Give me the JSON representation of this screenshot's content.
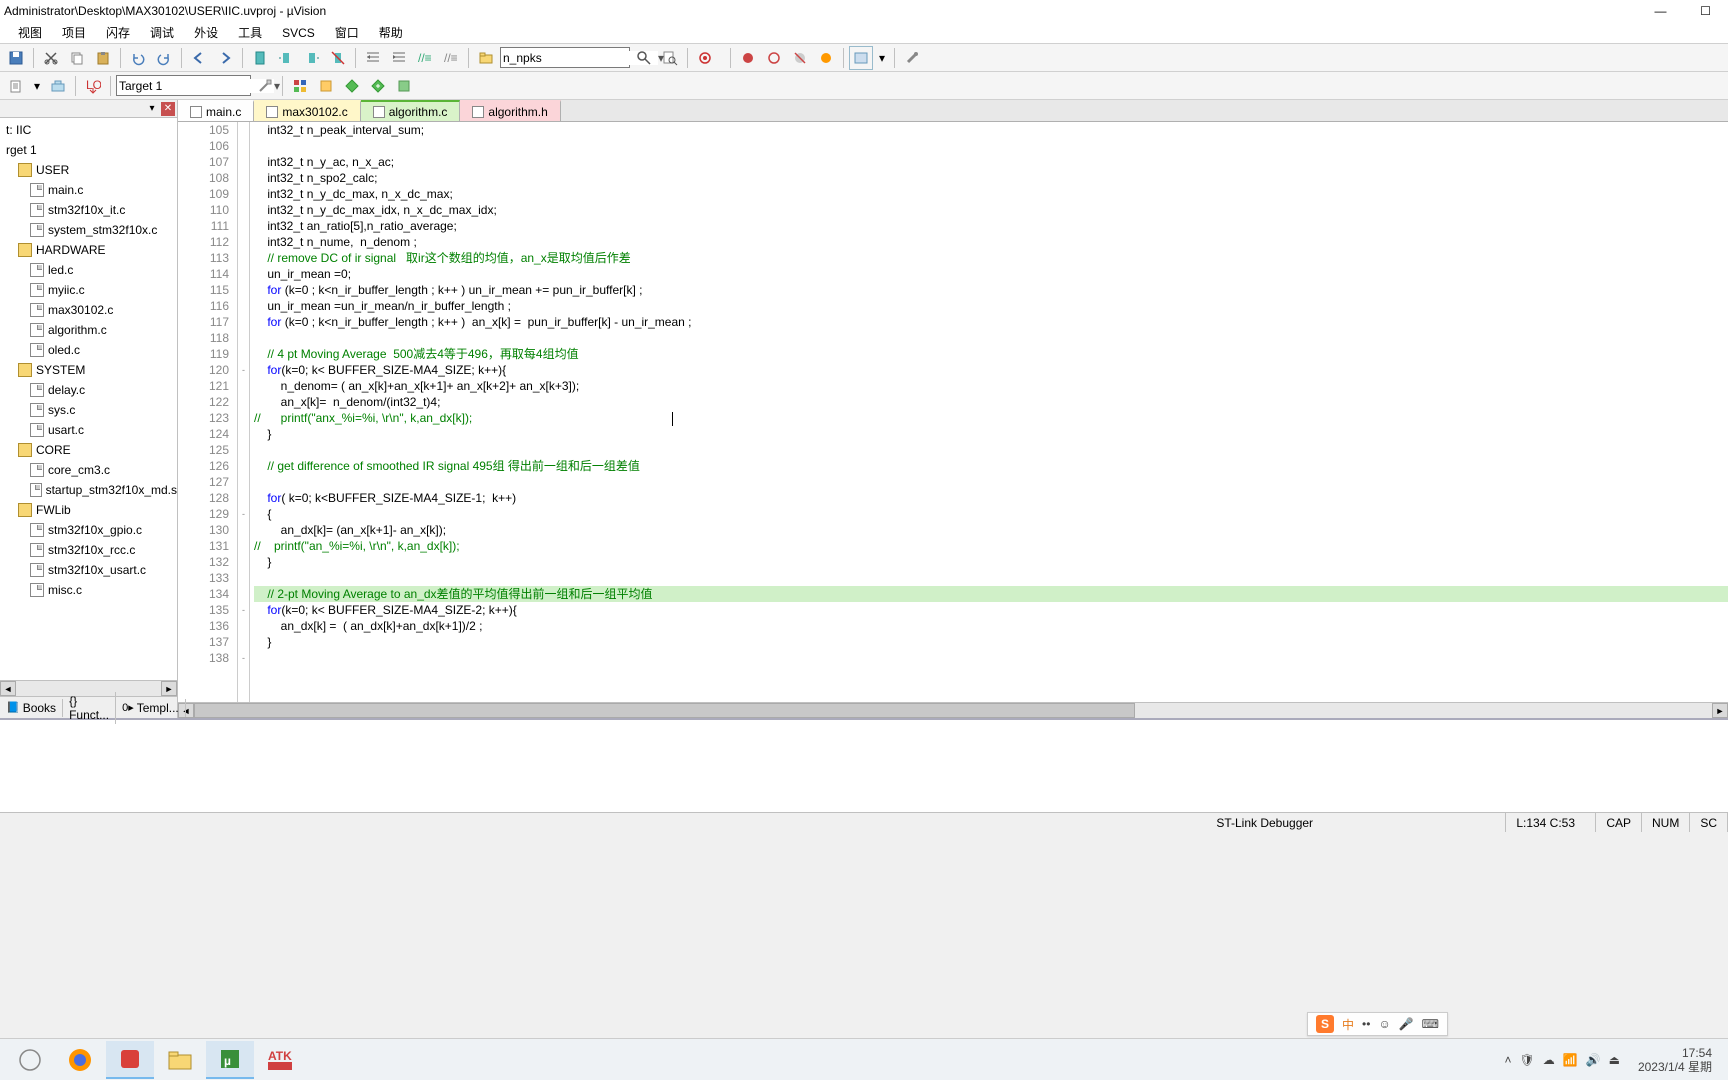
{
  "window": {
    "title": "Administrator\\Desktop\\MAX30102\\USER\\IIC.uvproj - µVision"
  },
  "menu": [
    "视图",
    "项目",
    "闪存",
    "调试",
    "外设",
    "工具",
    "SVCS",
    "窗口",
    "帮助"
  ],
  "toolbar1": {
    "combo": "n_npks"
  },
  "toolbar2": {
    "target": "Target 1"
  },
  "project": {
    "breadcrumb": "t: IIC",
    "target": "rget 1",
    "groups": [
      {
        "name": "USER",
        "files": [
          "main.c",
          "stm32f10x_it.c",
          "system_stm32f10x.c"
        ]
      },
      {
        "name": "HARDWARE",
        "files": [
          "led.c",
          "myiic.c",
          "max30102.c",
          "algorithm.c",
          "oled.c"
        ]
      },
      {
        "name": "SYSTEM",
        "files": [
          "delay.c",
          "sys.c",
          "usart.c"
        ]
      },
      {
        "name": "CORE",
        "files": [
          "core_cm3.c",
          "startup_stm32f10x_md.s"
        ]
      },
      {
        "name": "FWLib",
        "files": [
          "stm32f10x_gpio.c",
          "stm32f10x_rcc.c",
          "stm32f10x_usart.c",
          "misc.c"
        ]
      }
    ],
    "tabs": {
      "books": "Books",
      "funcs": "{} Funct...",
      "templates": "Templ..."
    }
  },
  "editor": {
    "tabs": [
      {
        "name": "main.c",
        "style": "inactive"
      },
      {
        "name": "max30102.c",
        "style": "yellow"
      },
      {
        "name": "algorithm.c",
        "style": "green"
      },
      {
        "name": "algorithm.h",
        "style": "pink"
      }
    ],
    "first_line": 105,
    "lines": [
      {
        "raw": "    int32_t n_peak_interval_sum;"
      },
      {
        "raw": ""
      },
      {
        "raw": "    int32_t n_y_ac, n_x_ac;"
      },
      {
        "raw": "    int32_t n_spo2_calc;"
      },
      {
        "raw": "    int32_t n_y_dc_max, n_x_dc_max;"
      },
      {
        "raw": "    int32_t n_y_dc_max_idx, n_x_dc_max_idx;"
      },
      {
        "raw": "    int32_t an_ratio[5],n_ratio_average;"
      },
      {
        "raw": "    int32_t n_nume,  n_denom ;"
      },
      {
        "cmt": "    // remove DC of ir signal   取ir这个数组的均值，an_x是取均值后作差"
      },
      {
        "raw": "    un_ir_mean =0;"
      },
      {
        "kwfor": true,
        "raw": "    for (k=0 ; k<n_ir_buffer_length ; k++ ) un_ir_mean += pun_ir_buffer[k] ;"
      },
      {
        "raw": "    un_ir_mean =un_ir_mean/n_ir_buffer_length ;"
      },
      {
        "kwfor": true,
        "raw": "    for (k=0 ; k<n_ir_buffer_length ; k++ )  an_x[k] =  pun_ir_buffer[k] - un_ir_mean ;"
      },
      {
        "raw": ""
      },
      {
        "cmt": "    // 4 pt Moving Average  500减去4等于496，再取每4组均值"
      },
      {
        "fold": "-",
        "kwfor": true,
        "raw": "    for(k=0; k< BUFFER_SIZE-MA4_SIZE; k++){"
      },
      {
        "raw": "        n_denom= ( an_x[k]+an_x[k+1]+ an_x[k+2]+ an_x[k+3]);"
      },
      {
        "raw": "        an_x[k]=  n_denom/(int32_t)4;"
      },
      {
        "cmt": "//      printf(\"anx_%i=%i, \\r\\n\", k,an_dx[k]);",
        "caret": true
      },
      {
        "raw": "    }"
      },
      {
        "raw": ""
      },
      {
        "cmt": "    // get difference of smoothed IR signal 495组 得出前一组和后一组差值"
      },
      {
        "raw": ""
      },
      {
        "kwfor": true,
        "raw": "    for( k=0; k<BUFFER_SIZE-MA4_SIZE-1;  k++)"
      },
      {
        "fold": "-",
        "raw": "    {"
      },
      {
        "raw": "        an_dx[k]= (an_x[k+1]- an_x[k]);"
      },
      {
        "cmt": "//    printf(\"an_%i=%i, \\r\\n\", k,an_dx[k]);"
      },
      {
        "raw": "    }"
      },
      {
        "raw": ""
      },
      {
        "hl": true,
        "cmt": "    // 2-pt Moving Average to an_dx差值的平均值得出前一组和后一组平均值"
      },
      {
        "fold": "-",
        "kwfor": true,
        "raw": "    for(k=0; k< BUFFER_SIZE-MA4_SIZE-2; k++){"
      },
      {
        "raw": "        an_dx[k] =  ( an_dx[k]+an_dx[k+1])/2 ;"
      },
      {
        "raw": "    }"
      },
      {
        "fold": "-",
        "raw": ""
      }
    ]
  },
  "status": {
    "debugger": "ST-Link Debugger",
    "cursor": "L:134 C:53",
    "caps": "CAP",
    "num": "NUM",
    "scroll": "SC"
  },
  "tray": {
    "ime_cn": "中",
    "time": "17:54",
    "date": "2023/1/4 星期"
  }
}
